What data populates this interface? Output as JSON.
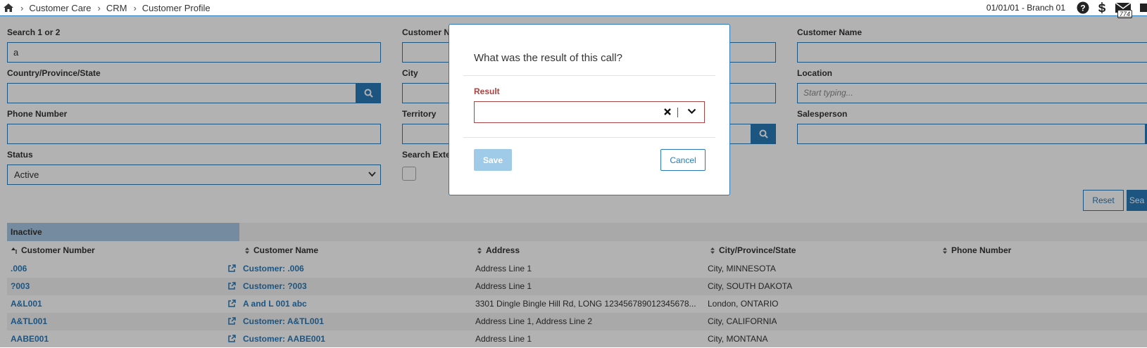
{
  "breadcrumb": [
    "Customer Care",
    "CRM",
    "Customer Profile"
  ],
  "header": {
    "date_branch": "01/01/01 - Branch 01",
    "mail_count": "774"
  },
  "form": {
    "search12": {
      "label": "Search 1 or 2",
      "value": "a"
    },
    "customer_number": {
      "label": "Customer N"
    },
    "customer_name": {
      "label": "Customer Name",
      "value": ""
    },
    "country": {
      "label": "Country/Province/State",
      "value": ""
    },
    "city": {
      "label": "City"
    },
    "location": {
      "label": "Location",
      "placeholder": "Start typing..."
    },
    "phone": {
      "label": "Phone Number",
      "value": ""
    },
    "territory": {
      "label": "Territory"
    },
    "salesperson": {
      "label": "Salesperson",
      "value": ""
    },
    "status": {
      "label": "Status",
      "value": "Active"
    },
    "search_external": {
      "label": "Search Exte"
    }
  },
  "buttons": {
    "reset": "Reset",
    "search": "Sea"
  },
  "table": {
    "inactive_tab": "Inactive",
    "columns": [
      "Customer Number",
      "Customer Name",
      "Address",
      "City/Province/State",
      "Phone Number"
    ],
    "rows": [
      {
        "number": ".006",
        "name": "Customer: .006",
        "address": "Address Line 1",
        "city": "City, MINNESOTA",
        "phone": ""
      },
      {
        "number": "?003",
        "name": "Customer: ?003",
        "address": "Address Line 1",
        "city": "City, SOUTH DAKOTA",
        "phone": ""
      },
      {
        "number": "A&L001",
        "name": "A and L 001 abc",
        "address": "3301 Dingle Bingle Hill Rd, LONG 123456789012345678...",
        "city": "London, ONTARIO",
        "phone": ""
      },
      {
        "number": "A&TL001",
        "name": "Customer: A&TL001",
        "address": "Address Line 1, Address Line 2",
        "city": "City, CALIFORNIA",
        "phone": ""
      },
      {
        "number": "AABE001",
        "name": "Customer: AABE001",
        "address": "Address Line 1",
        "city": "City, MONTANA",
        "phone": ""
      }
    ]
  },
  "modal": {
    "question": "What was the result of this call?",
    "result_label": "Result",
    "result_value": "",
    "save": "Save",
    "cancel": "Cancel"
  },
  "colors": {
    "accent": "#2a7ab9",
    "error": "#a94442",
    "save_disabled": "#9fcbe9"
  }
}
